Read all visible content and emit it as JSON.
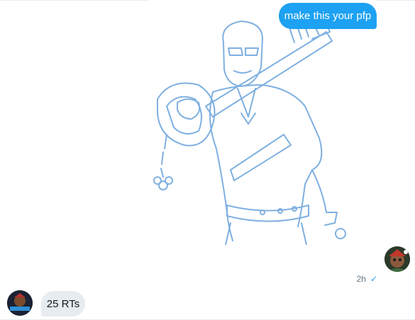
{
  "conversation": {
    "outgoing_message": {
      "text": "make this your pfp",
      "time": "2h",
      "status": "✓",
      "bubble_color": "#1da1f2"
    },
    "incoming_message": {
      "text": "25 RTs",
      "bubble_color": "#e6ecf0"
    },
    "media_image": {
      "subject": "blue pencil sketch of a cartoon man in glasses holding a large key-shaped sword over his shoulder",
      "line_color": "#7fb0e0"
    }
  }
}
